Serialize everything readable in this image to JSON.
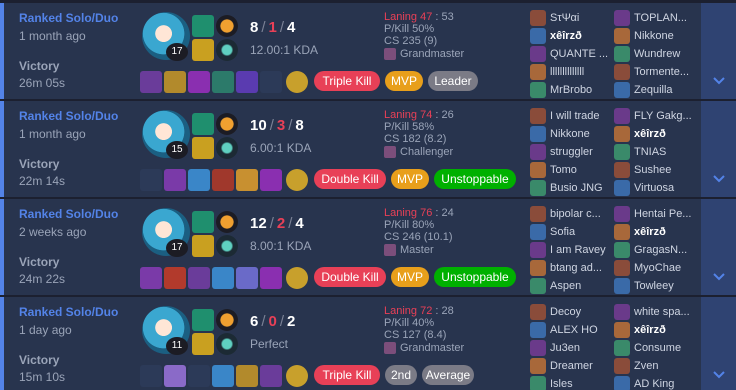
{
  "matches": [
    {
      "queue": "Ranked Solo/Duo",
      "ago": "1 month ago",
      "result": "Victory",
      "duration": "26m 05s",
      "level": "17",
      "kills": "8",
      "deaths": "1",
      "assists": "4",
      "kda_ratio": "12.00:1 KDA",
      "laning_label": "Laning 47",
      "laning_sep": " : ",
      "laning_other": "53",
      "pkill": "P/Kill 50%",
      "cs": "CS 235 (9)",
      "avg_rank": "Grandmaster",
      "badges": [
        "Triple Kill",
        "MVP",
        "Leader"
      ],
      "blue_team": [
        "SτΨαi",
        "xêîrzð",
        "QUANTE ...",
        "llllllllllllll",
        "MrBrobo"
      ],
      "red_team": [
        "TOPLAN...",
        "Nikkone",
        "Wundrew",
        "Tormente...",
        "Zequilla"
      ]
    },
    {
      "queue": "Ranked Solo/Duo",
      "ago": "1 month ago",
      "result": "Victory",
      "duration": "22m 14s",
      "level": "15",
      "kills": "10",
      "deaths": "3",
      "assists": "8",
      "kda_ratio": "6.00:1 KDA",
      "laning_label": "Laning 74",
      "laning_sep": " : ",
      "laning_other": "26",
      "pkill": "P/Kill 58%",
      "cs": "CS 182 (8.2)",
      "avg_rank": "Challenger",
      "badges": [
        "Double Kill",
        "MVP",
        "Unstoppable"
      ],
      "blue_team": [
        "I will trade",
        "Nikkone",
        "struggler",
        "Tomo",
        "Busio JNG"
      ],
      "red_team": [
        "FLY Gakg...",
        "xêîrzð",
        "TNIAS",
        "Sushee",
        "Virtuosa"
      ]
    },
    {
      "queue": "Ranked Solo/Duo",
      "ago": "2 weeks ago",
      "result": "Victory",
      "duration": "24m 22s",
      "level": "17",
      "kills": "12",
      "deaths": "2",
      "assists": "4",
      "kda_ratio": "8.00:1 KDA",
      "laning_label": "Laning 76",
      "laning_sep": " : ",
      "laning_other": "24",
      "pkill": "P/Kill 80%",
      "cs": "CS 246 (10.1)",
      "avg_rank": "Master",
      "badges": [
        "Double Kill",
        "MVP",
        "Unstoppable"
      ],
      "blue_team": [
        "bipolar c...",
        "Sofia",
        "I am Ravey",
        "btang ad...",
        "Aspen"
      ],
      "red_team": [
        "Hentai Pe...",
        "xêîrzð",
        "GragasN...",
        "MyoChae",
        "Towleey"
      ]
    },
    {
      "queue": "Ranked Solo/Duo",
      "ago": "1 day ago",
      "result": "Victory",
      "duration": "15m 10s",
      "level": "11",
      "kills": "6",
      "deaths": "0",
      "assists": "2",
      "kda_ratio": "Perfect",
      "laning_label": "Laning 72",
      "laning_sep": " : ",
      "laning_other": "28",
      "pkill": "P/Kill 40%",
      "cs": "CS 127 (8.4)",
      "avg_rank": "Grandmaster",
      "badges": [
        "Triple Kill",
        "2nd",
        "Average"
      ],
      "blue_team": [
        "Decoy",
        "ALEX HO",
        "Ju3en",
        "Dreamer",
        "Isles"
      ],
      "red_team": [
        "white spa...",
        "xêîrzð",
        "Consume",
        "Zven",
        "AD King"
      ]
    }
  ],
  "highlight_player": "xêîrzð",
  "colors": {
    "win_border": "#5383e8",
    "card_bg": "#28344e",
    "expand_bg": "#2f4372",
    "multikill_red": "#e84057",
    "mvp_gold": "#e89f1b",
    "unstoppable_green": "#00b000",
    "neutral_gray": "#7b7b86"
  },
  "icons": {
    "expand": "chevron-down-icon"
  }
}
